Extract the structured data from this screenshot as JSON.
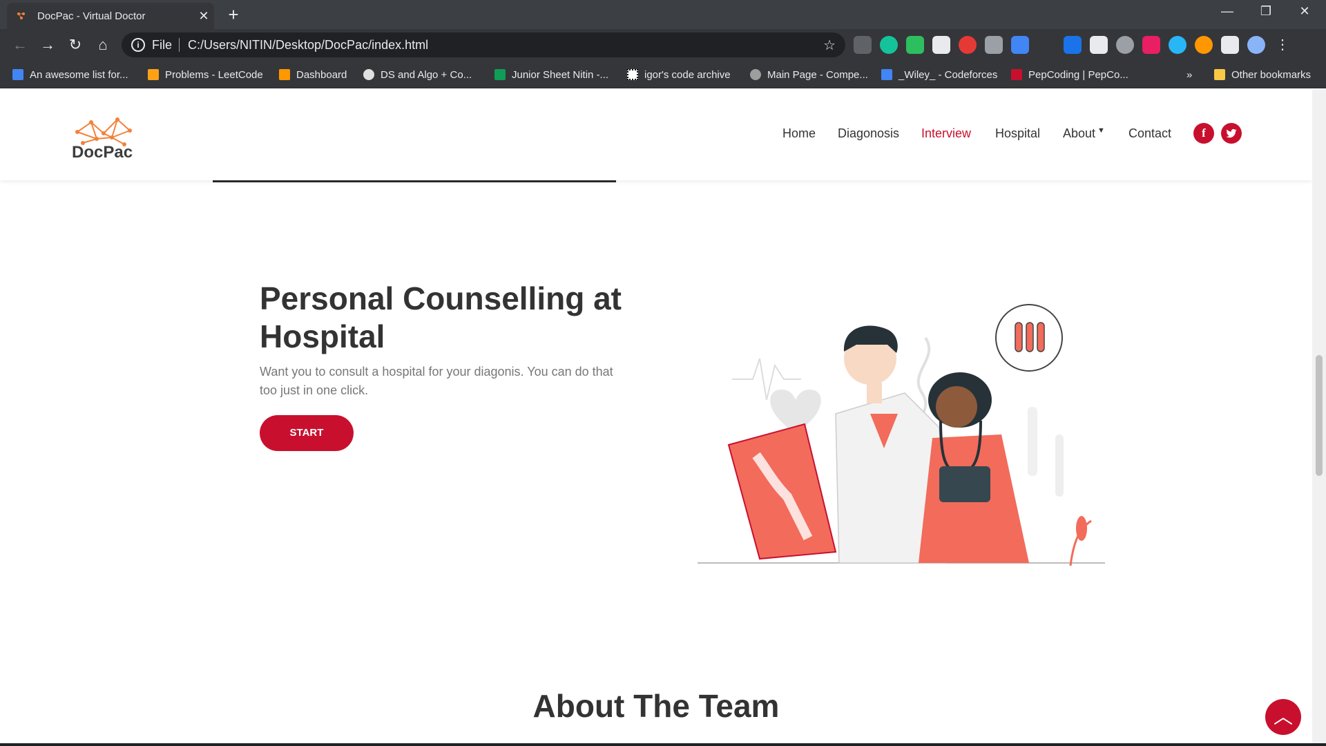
{
  "browser": {
    "tab_title": "DocPac - Virtual Doctor",
    "tab_close": "✕",
    "new_tab": "+",
    "url_scheme": "File",
    "url_path": "C:/Users/NITIN/Desktop/DocPac/index.html"
  },
  "bookmarks": [
    {
      "label": "An awesome list for...",
      "color": "#4285f4"
    },
    {
      "label": "Problems - LeetCode",
      "color": "#ffa116"
    },
    {
      "label": "Dashboard",
      "color": "#ff9800"
    },
    {
      "label": "DS and Algo + Co...",
      "color": "#e0e0e0"
    },
    {
      "label": "Junior Sheet Nitin -...",
      "color": "#0f9d58"
    },
    {
      "label": "igor's code archive",
      "color": "#ffffff"
    },
    {
      "label": "Main Page - Compe...",
      "color": "#9e9e9e"
    },
    {
      "label": "_Wiley_ - Codeforces",
      "color": "#4285f4"
    },
    {
      "label": "PepCoding | PepCo...",
      "color": "#c8102e"
    }
  ],
  "bookmarks_more": "»",
  "other_bookmarks": "Other bookmarks",
  "site": {
    "logo_text": "DocPac",
    "nav": [
      "Home",
      "Diagonosis",
      "Interview",
      "Hospital",
      "About",
      "Contact"
    ],
    "nav_active": "Interview",
    "social_fb": "f",
    "social_tw": "t"
  },
  "section": {
    "headline": "Personal Counselling at Hospital",
    "body": "Want you to consult a hospital for your diagonis. You can do that too just in one click.",
    "button": "START"
  },
  "team": {
    "title": "About The Team"
  },
  "scroll_top_icon": "︿",
  "colors": {
    "accent": "#c8102e",
    "illustration_coral": "#f26b5b",
    "chrome_dark": "#35363a"
  }
}
